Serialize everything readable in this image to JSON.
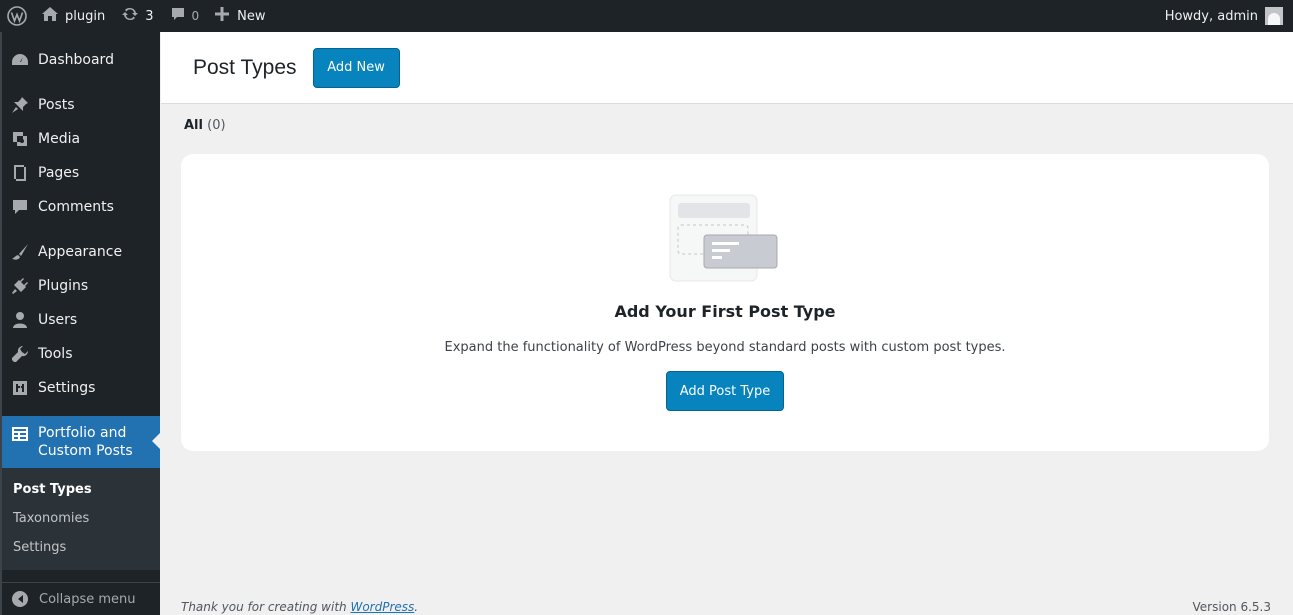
{
  "admin_bar": {
    "site_name": "plugin",
    "updates_count": "3",
    "comments_count": "0",
    "new_label": "New",
    "greeting": "Howdy, admin"
  },
  "sidebar": {
    "items": [
      {
        "label": "Dashboard",
        "icon": "dashboard-icon"
      },
      {
        "label": "Posts",
        "icon": "pin-icon"
      },
      {
        "label": "Media",
        "icon": "media-icon"
      },
      {
        "label": "Pages",
        "icon": "pages-icon"
      },
      {
        "label": "Comments",
        "icon": "comment-icon"
      },
      {
        "label": "Appearance",
        "icon": "brush-icon"
      },
      {
        "label": "Plugins",
        "icon": "plugin-icon"
      },
      {
        "label": "Users",
        "icon": "user-icon"
      },
      {
        "label": "Tools",
        "icon": "wrench-icon"
      },
      {
        "label": "Settings",
        "icon": "settings-icon"
      },
      {
        "label_line1": "Portfolio and",
        "label_line2": "Custom Posts",
        "icon": "portfolio-icon",
        "current": true
      }
    ],
    "submenu": [
      "Post Types",
      "Taxonomies",
      "Settings"
    ],
    "collapse_label": "Collapse menu"
  },
  "header": {
    "title": "Post Types",
    "add_new_label": "Add New"
  },
  "filters": {
    "all_label": "All",
    "all_count": "(0)"
  },
  "empty_state": {
    "heading": "Add Your First Post Type",
    "description": "Expand the functionality of WordPress beyond standard posts with custom post types.",
    "button_label": "Add Post Type"
  },
  "footer": {
    "thanks_prefix": "Thank you for creating with",
    "wordpress_link": "WordPress",
    "thanks_suffix": ".",
    "version": "Version 6.5.3"
  },
  "colors": {
    "primary": "#0783be",
    "admin_bar": "#1d2327",
    "current_menu": "#2271b1",
    "background": "#f0f0f1"
  }
}
